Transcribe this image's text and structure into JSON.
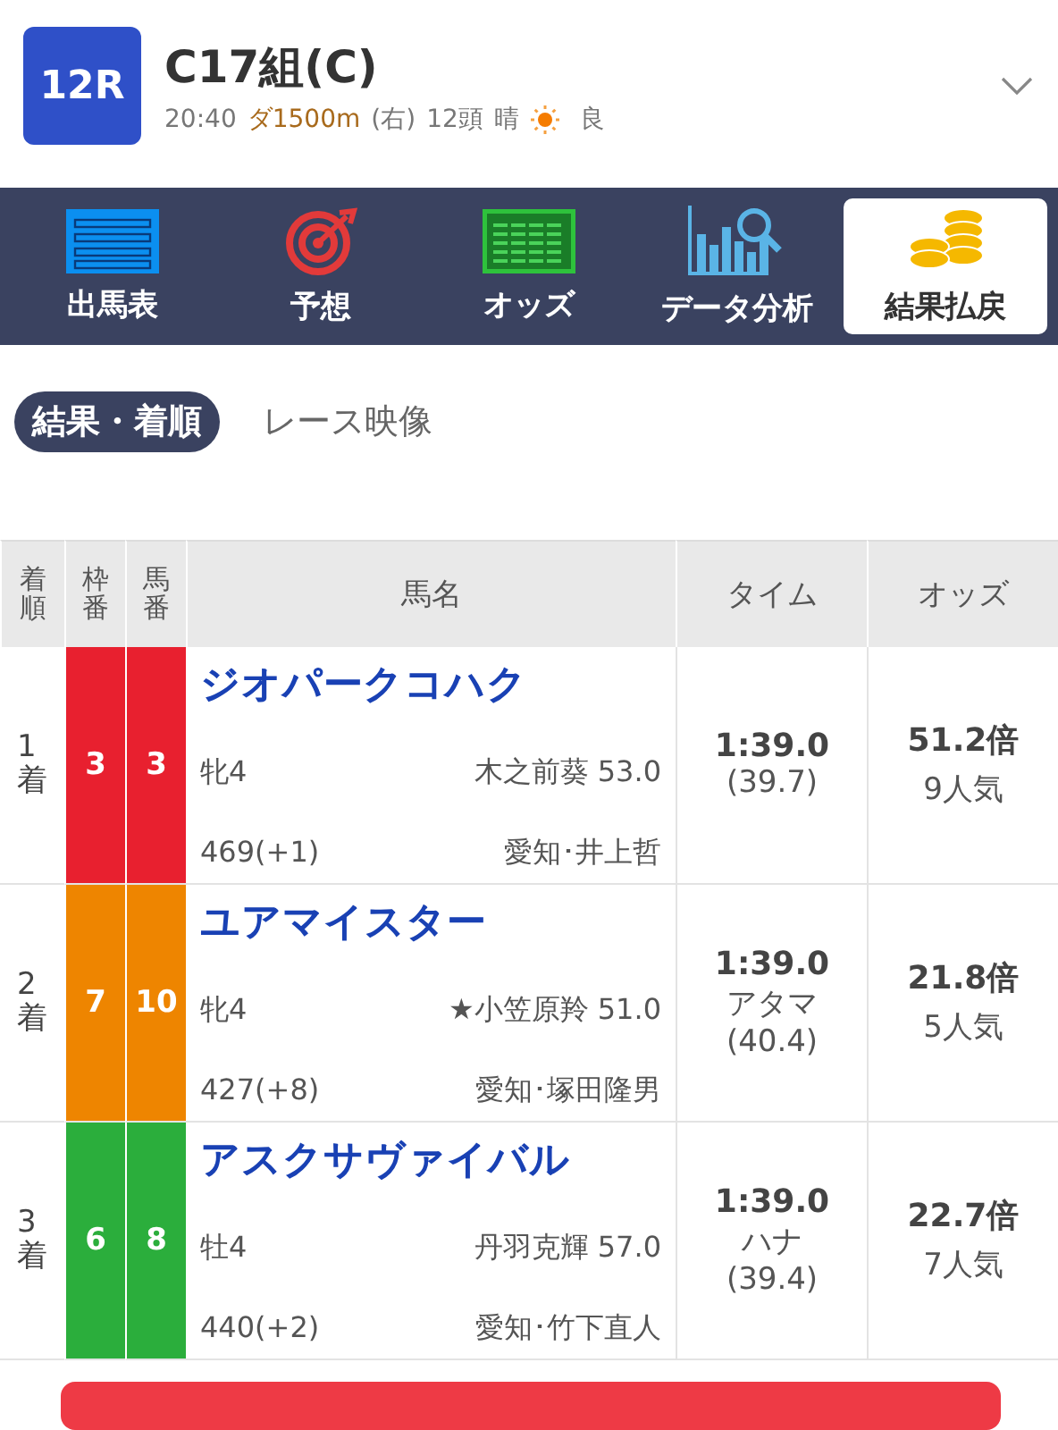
{
  "race": {
    "number": "12R",
    "title": "C17組(C)",
    "time": "20:40",
    "course": "ダ1500m",
    "direction": "(右)",
    "runners": "12頭",
    "weather": "晴",
    "going": "良"
  },
  "nav": [
    {
      "label": "出馬表",
      "kind": "list",
      "selected": false
    },
    {
      "label": "予想",
      "kind": "target",
      "selected": false
    },
    {
      "label": "オッズ",
      "kind": "grid",
      "selected": false
    },
    {
      "label": "データ分析",
      "kind": "chart",
      "selected": false
    },
    {
      "label": "結果払戻",
      "kind": "coins",
      "selected": true
    }
  ],
  "subtabs": [
    {
      "label": "結果・着順",
      "selected": true
    },
    {
      "label": "レース映像",
      "selected": false
    }
  ],
  "table": {
    "columns": [
      "着順",
      "枠番",
      "馬番",
      "馬名",
      "タイム",
      "オッズ"
    ],
    "rows": [
      {
        "place": "1着",
        "frame": "3",
        "number": "3",
        "color": "#e8202f",
        "name": "ジオパークコハク",
        "sex_age": "牝4",
        "jockey": "木之前葵 53.0",
        "weight": "469(+1)",
        "trainer": "愛知･井上哲",
        "time": "1:39.0",
        "last3f": "(39.7)",
        "odds": "51.2倍",
        "popularity": "9人気"
      },
      {
        "place": "2着",
        "frame": "7",
        "number": "10",
        "color": "#ee8500",
        "name": "ユアマイスター",
        "sex_age": "牝4",
        "jockey": "★小笠原羚 51.0",
        "weight": "427(+8)",
        "trainer": "愛知･塚田隆男",
        "time": "1:39.0",
        "margin": "アタマ",
        "last3f": "(40.4)",
        "odds": "21.8倍",
        "popularity": "5人気"
      },
      {
        "place": "3着",
        "frame": "6",
        "number": "8",
        "color": "#2bae3c",
        "name": "アスクサヴァイバル",
        "sex_age": "牡4",
        "jockey": "丹羽克輝 57.0",
        "weight": "440(+2)",
        "trainer": "愛知･竹下直人",
        "time": "1:39.0",
        "margin": "ハナ",
        "last3f": "(39.4)",
        "odds": "22.7倍",
        "popularity": "7人気"
      }
    ]
  }
}
